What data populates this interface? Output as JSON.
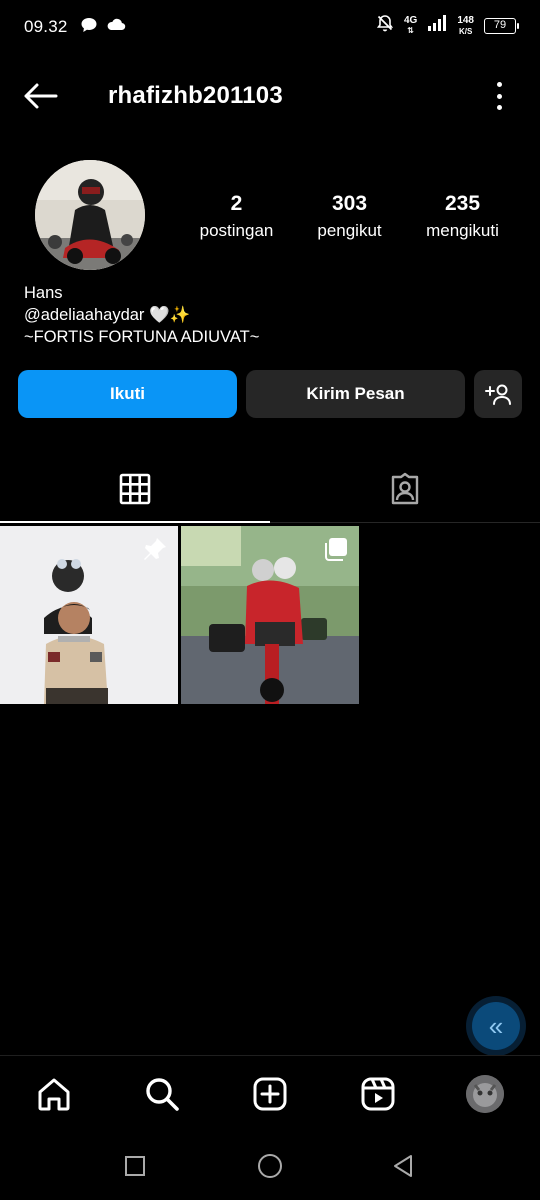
{
  "status_bar": {
    "time": "09.32",
    "network": "4G",
    "speed_value": "148",
    "speed_unit": "K/S",
    "battery": "79"
  },
  "header": {
    "username": "rhafizhb201103"
  },
  "profile": {
    "stats": [
      {
        "value": "2",
        "label": "postingan"
      },
      {
        "value": "303",
        "label": "pengikut"
      },
      {
        "value": "235",
        "label": "mengikuti"
      }
    ],
    "bio": {
      "name": "Hans",
      "line1": "@adeliaahaydar 🤍✨",
      "line2": "~FORTIS FORTUNA ADIUVAT~"
    }
  },
  "actions": {
    "follow_label": "Ikuti",
    "message_label": "Kirim Pesan"
  },
  "colors": {
    "follow_button": "#0a95f6",
    "secondary_button": "#262626",
    "background": "#000000"
  },
  "icons": {
    "back": "arrow-left-icon",
    "more": "more-vertical-icon",
    "suggest": "add-person-icon",
    "grid": "grid-icon",
    "tagged": "tagged-person-icon",
    "pin": "pin-icon",
    "multi": "carousel-icon",
    "home": "home-icon",
    "search": "search-icon",
    "create": "create-icon",
    "reels": "reels-icon"
  }
}
